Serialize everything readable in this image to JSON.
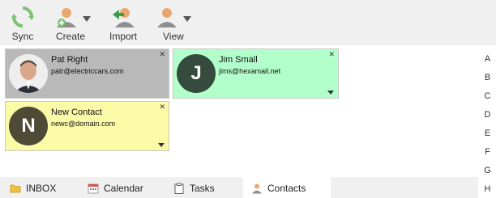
{
  "toolbar": {
    "sync": {
      "label": "Sync",
      "icon": "sync-icon"
    },
    "create": {
      "label": "Create",
      "icon": "add-contact-icon"
    },
    "import": {
      "label": "Import",
      "icon": "import-contact-icon"
    },
    "view": {
      "label": "View",
      "icon": "view-contact-icon"
    }
  },
  "contacts": [
    {
      "name": "Pat Right",
      "email": "patr@electriccars.com",
      "color": "#b9b9b9",
      "avatar": "photo"
    },
    {
      "name": "Jim Small",
      "email": "jims@hexamail.net",
      "color": "#b3ffcc",
      "avatar": "J",
      "avatar_color": "#344b3d"
    },
    {
      "name": "New Contact",
      "email": "newc@domain.com",
      "color": "#fbfba7",
      "avatar": "N",
      "avatar_color": "#4d4a36"
    }
  ],
  "card": {
    "close_glyph": "✕"
  },
  "alphabet": [
    "A",
    "B",
    "C",
    "D",
    "E",
    "F",
    "G",
    "H"
  ],
  "nav": [
    {
      "label": "INBOX",
      "icon": "folder-icon"
    },
    {
      "label": "Calendar",
      "icon": "calendar-icon"
    },
    {
      "label": "Tasks",
      "icon": "clipboard-icon"
    },
    {
      "label": "Contacts",
      "icon": "person-icon",
      "active": true
    }
  ]
}
